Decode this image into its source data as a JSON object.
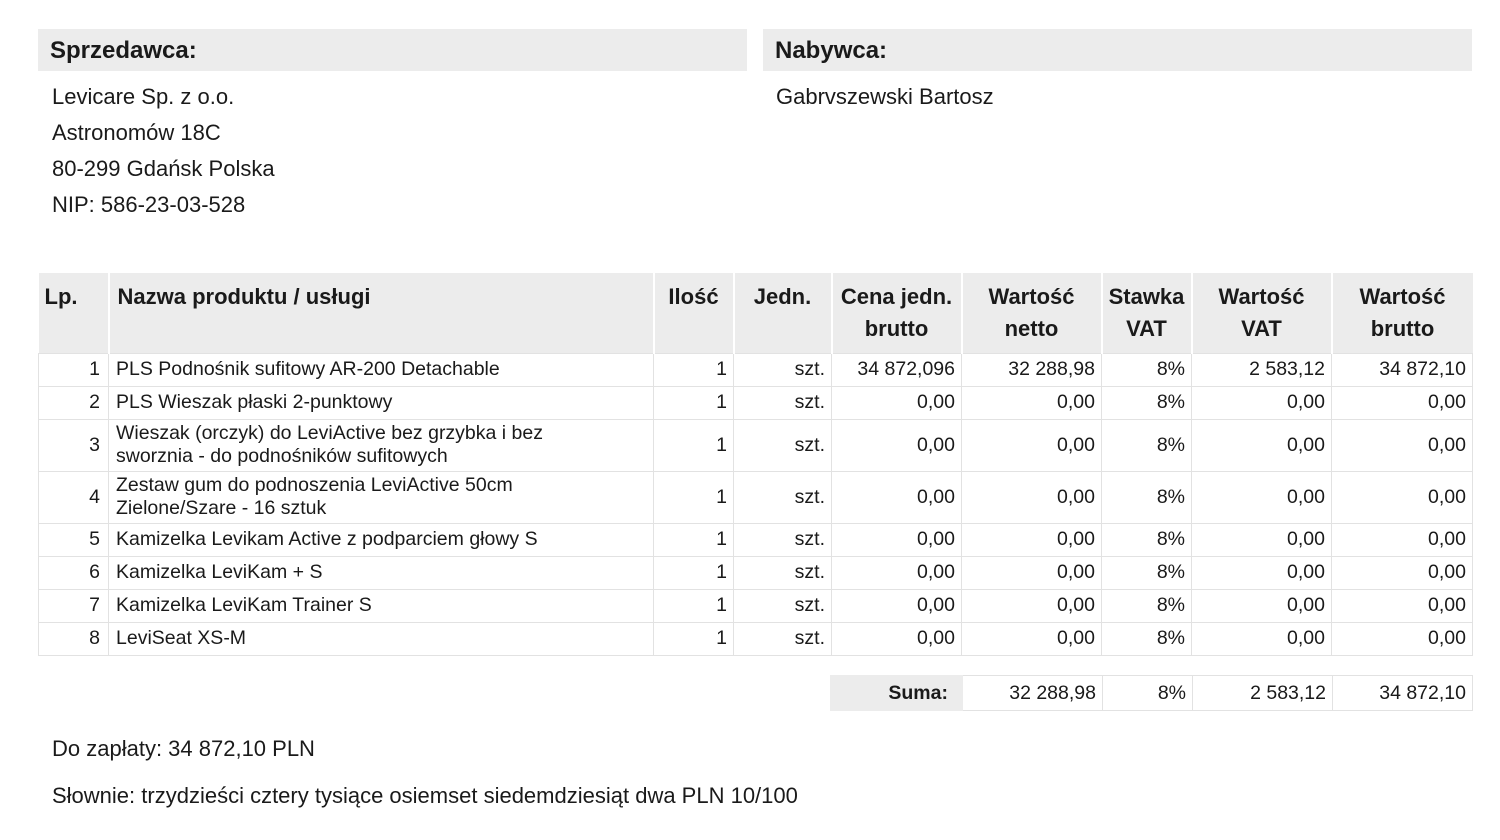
{
  "seller": {
    "heading": "Sprzedawca:",
    "lines": [
      "Levicare Sp. z o.o.",
      "Astronomów 18C",
      "80-299 Gdańsk Polska",
      "NIP: 586-23-03-528"
    ]
  },
  "buyer": {
    "heading": "Nabywca:",
    "lines": [
      "Gabrvszewski Bartosz"
    ]
  },
  "table": {
    "headers": {
      "lp": "Lp.",
      "name": "Nazwa produktu / usługi",
      "qty": "Ilość",
      "unit": "Jedn.",
      "price_1": "Cena jedn.",
      "price_2": "brutto",
      "net_1": "Wartość",
      "net_2": "netto",
      "rate_1": "Stawka",
      "rate_2": "VAT",
      "vat_1": "Wartość",
      "vat_2": "VAT",
      "gross_1": "Wartość",
      "gross_2": "brutto"
    },
    "rows": [
      {
        "lp": "1",
        "name_1": "PLS Podnośnik sufitowy AR-200 Detachable",
        "name_2": "",
        "qty": "1",
        "unit": "szt.",
        "price": "34 872,096",
        "net": "32 288,98",
        "rate": "8%",
        "vat": "2 583,12",
        "gross": "34 872,10"
      },
      {
        "lp": "2",
        "name_1": "PLS Wieszak płaski 2-punktowy",
        "name_2": "",
        "qty": "1",
        "unit": "szt.",
        "price": "0,00",
        "net": "0,00",
        "rate": "8%",
        "vat": "0,00",
        "gross": "0,00"
      },
      {
        "lp": "3",
        "name_1": "Wieszak (orczyk) do LeviActive bez grzybka i bez",
        "name_2": "sworznia - do podnośników sufitowych",
        "qty": "1",
        "unit": "szt.",
        "price": "0,00",
        "net": "0,00",
        "rate": "8%",
        "vat": "0,00",
        "gross": "0,00"
      },
      {
        "lp": "4",
        "name_1": "Zestaw gum do podnoszenia LeviActive 50cm",
        "name_2": "Zielone/Szare - 16 sztuk",
        "qty": "1",
        "unit": "szt.",
        "price": "0,00",
        "net": "0,00",
        "rate": "8%",
        "vat": "0,00",
        "gross": "0,00"
      },
      {
        "lp": "5",
        "name_1": "Kamizelka Levikam Active z podparciem głowy S",
        "name_2": "",
        "qty": "1",
        "unit": "szt.",
        "price": "0,00",
        "net": "0,00",
        "rate": "8%",
        "vat": "0,00",
        "gross": "0,00"
      },
      {
        "lp": "6",
        "name_1": "Kamizelka LeviKam + S",
        "name_2": "",
        "qty": "1",
        "unit": "szt.",
        "price": "0,00",
        "net": "0,00",
        "rate": "8%",
        "vat": "0,00",
        "gross": "0,00"
      },
      {
        "lp": "7",
        "name_1": "Kamizelka LeviKam Trainer S",
        "name_2": "",
        "qty": "1",
        "unit": "szt.",
        "price": "0,00",
        "net": "0,00",
        "rate": "8%",
        "vat": "0,00",
        "gross": "0,00"
      },
      {
        "lp": "8",
        "name_1": "LeviSeat XS-M",
        "name_2": "",
        "qty": "1",
        "unit": "szt.",
        "price": "0,00",
        "net": "0,00",
        "rate": "8%",
        "vat": "0,00",
        "gross": "0,00"
      }
    ]
  },
  "totals": {
    "label": "Suma:",
    "net": "32 288,98",
    "rate": "8%",
    "vat": "2 583,12",
    "gross": "34 872,10"
  },
  "payment": {
    "to_pay": "Do zapłaty: 34 872,10 PLN",
    "in_words": "Słownie: trzydzieści cztery tysiące osiemset siedemdziesiąt dwa  PLN 10/100"
  }
}
